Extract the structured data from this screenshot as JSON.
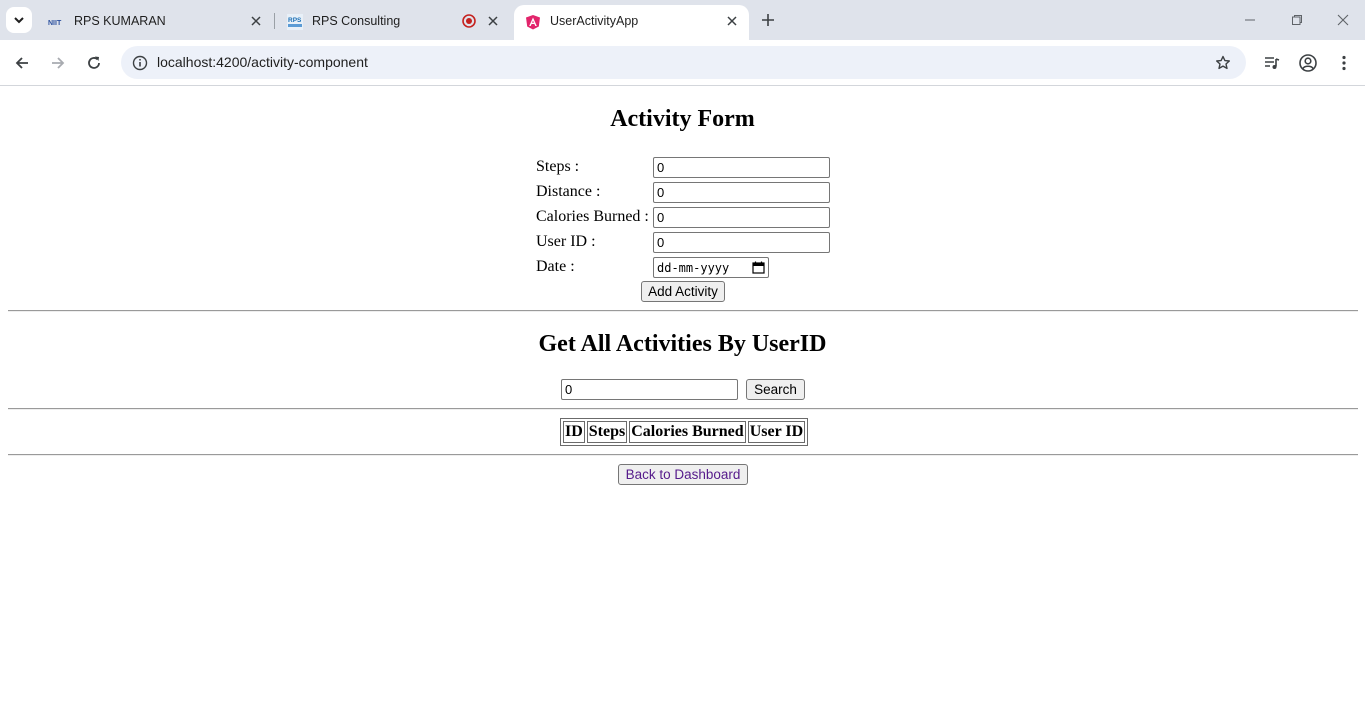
{
  "browser": {
    "tabs": [
      {
        "title": "RPS KUMARAN",
        "favicon": "niit-logo-icon",
        "active": false
      },
      {
        "title": "RPS Consulting",
        "favicon": "rps-logo-icon",
        "recording": true,
        "active": false
      },
      {
        "title": "UserActivityApp",
        "favicon": "angular-icon",
        "active": true
      }
    ],
    "url": "localhost:4200/activity-component"
  },
  "activity_form": {
    "heading": "Activity Form",
    "fields": [
      {
        "label": "Steps :",
        "value": "0"
      },
      {
        "label": "Distance :",
        "value": "0"
      },
      {
        "label": "Calories Burned :",
        "value": "0"
      },
      {
        "label": "User ID :",
        "value": "0"
      }
    ],
    "date": {
      "label": "Date :",
      "placeholder": "dd-mm-yyyy"
    },
    "submit_label": "Add Activity"
  },
  "search": {
    "heading": "Get All Activities By UserID",
    "value": "0",
    "button_label": "Search"
  },
  "table": {
    "columns": [
      "ID",
      "Steps",
      "Calories Burned",
      "User ID"
    ],
    "rows": []
  },
  "back_label": "Back to Dashboard"
}
